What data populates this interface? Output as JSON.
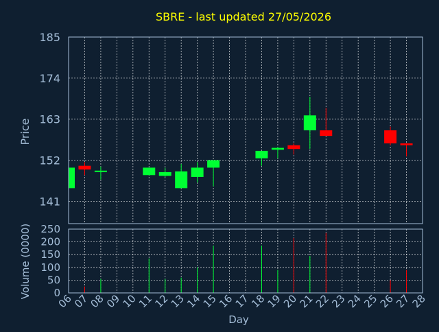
{
  "chart_data": [
    {
      "type": "candlestick",
      "title": "SBRE - last updated 27/05/2026",
      "ylabel": "Price",
      "xlabel": "",
      "ylim": [
        135,
        185
      ],
      "yticks": [
        141,
        152,
        163,
        174,
        185
      ],
      "grid": true,
      "x_tick_labels": [
        "06",
        "07",
        "08",
        "09",
        "10",
        "11",
        "12",
        "13",
        "14",
        "15",
        "16",
        "17",
        "18",
        "19",
        "20",
        "21",
        "22",
        "23",
        "24",
        "25",
        "26",
        "27",
        "28"
      ],
      "candles": [
        {
          "day": "06",
          "open": 144.5,
          "close": 150.0,
          "high": 150.0,
          "low": 144.5
        },
        {
          "day": "07",
          "open": 150.5,
          "close": 149.5,
          "high": 151.5,
          "low": 148.0
        },
        {
          "day": "08",
          "open": 148.8,
          "close": 149.2,
          "high": 150.3,
          "low": 146.8
        },
        {
          "day": "11",
          "open": 148.0,
          "close": 150.0,
          "high": 150.0,
          "low": 148.0
        },
        {
          "day": "12",
          "open": 147.8,
          "close": 148.8,
          "high": 150.0,
          "low": 147.5
        },
        {
          "day": "13",
          "open": 144.5,
          "close": 149.0,
          "high": 151.0,
          "low": 144.5
        },
        {
          "day": "14",
          "open": 147.5,
          "close": 150.0,
          "high": 151.5,
          "low": 146.0
        },
        {
          "day": "15",
          "open": 150.0,
          "close": 152.0,
          "high": 152.0,
          "low": 145.0
        },
        {
          "day": "18",
          "open": 152.5,
          "close": 154.5,
          "high": 154.5,
          "low": 150.5
        },
        {
          "day": "19",
          "open": 154.8,
          "close": 155.3,
          "high": 155.5,
          "low": 152.5
        },
        {
          "day": "20",
          "open": 156.0,
          "close": 155.0,
          "high": 156.5,
          "low": 153.5
        },
        {
          "day": "21",
          "open": 160.0,
          "close": 164.0,
          "high": 169.0,
          "low": 155.0
        },
        {
          "day": "22",
          "open": 160.0,
          "close": 158.5,
          "high": 166.0,
          "low": 158.5
        },
        {
          "day": "26",
          "open": 160.0,
          "close": 156.5,
          "high": 161.0,
          "low": 156.0
        },
        {
          "day": "27",
          "open": 156.5,
          "close": 156.0,
          "high": 156.5,
          "low": 153.0
        }
      ],
      "colors": {
        "up": "#00ff33",
        "down": "#ff0000"
      }
    },
    {
      "type": "bar",
      "ylabel": "Volume (0000)",
      "xlabel": "Day",
      "ylim": [
        0,
        250
      ],
      "yticks": [
        0,
        50,
        100,
        150,
        200,
        250
      ],
      "grid": true,
      "x_tick_labels": [
        "06",
        "07",
        "08",
        "09",
        "10",
        "11",
        "12",
        "13",
        "14",
        "15",
        "16",
        "17",
        "18",
        "19",
        "20",
        "21",
        "22",
        "23",
        "24",
        "25",
        "26",
        "27",
        "28"
      ],
      "bars": [
        {
          "day": "06",
          "value": 2,
          "dir": "up"
        },
        {
          "day": "07",
          "value": 25,
          "dir": "down"
        },
        {
          "day": "08",
          "value": 55,
          "dir": "up"
        },
        {
          "day": "11",
          "value": 135,
          "dir": "up"
        },
        {
          "day": "12",
          "value": 55,
          "dir": "up"
        },
        {
          "day": "13",
          "value": 60,
          "dir": "up"
        },
        {
          "day": "14",
          "value": 100,
          "dir": "up"
        },
        {
          "day": "15",
          "value": 185,
          "dir": "up"
        },
        {
          "day": "18",
          "value": 185,
          "dir": "up"
        },
        {
          "day": "19",
          "value": 90,
          "dir": "up"
        },
        {
          "day": "20",
          "value": 215,
          "dir": "down"
        },
        {
          "day": "21",
          "value": 145,
          "dir": "up"
        },
        {
          "day": "22",
          "value": 235,
          "dir": "down"
        },
        {
          "day": "26",
          "value": 50,
          "dir": "down"
        },
        {
          "day": "27",
          "value": 90,
          "dir": "down"
        }
      ]
    }
  ],
  "colors": {
    "background": "#0f1f30",
    "title": "#ffff00",
    "axis_text": "#a4bdd7",
    "grid": "#ffffff"
  }
}
